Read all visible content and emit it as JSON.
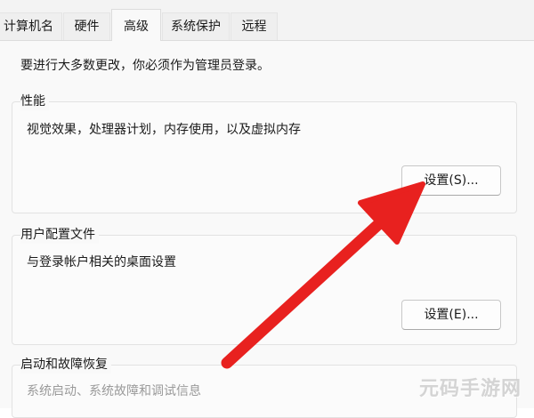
{
  "tabs": [
    {
      "label": "计算机名"
    },
    {
      "label": "硬件"
    },
    {
      "label": "高级",
      "active": true
    },
    {
      "label": "系统保护"
    },
    {
      "label": "远程"
    }
  ],
  "notice": "要进行大多数更改，你必须作为管理员登录。",
  "performance": {
    "title": "性能",
    "description": "视觉效果，处理器计划，内存使用，以及虚拟内存",
    "button": "设置(S)..."
  },
  "user_profiles": {
    "title": "用户配置文件",
    "description": "与登录帐户相关的桌面设置",
    "button": "设置(E)..."
  },
  "startup_recovery": {
    "title": "启动和故障恢复",
    "description": "系统启动、系统故障和调试信息"
  },
  "annotation": {
    "color": "#e8211f"
  },
  "watermark": "元码手游网"
}
